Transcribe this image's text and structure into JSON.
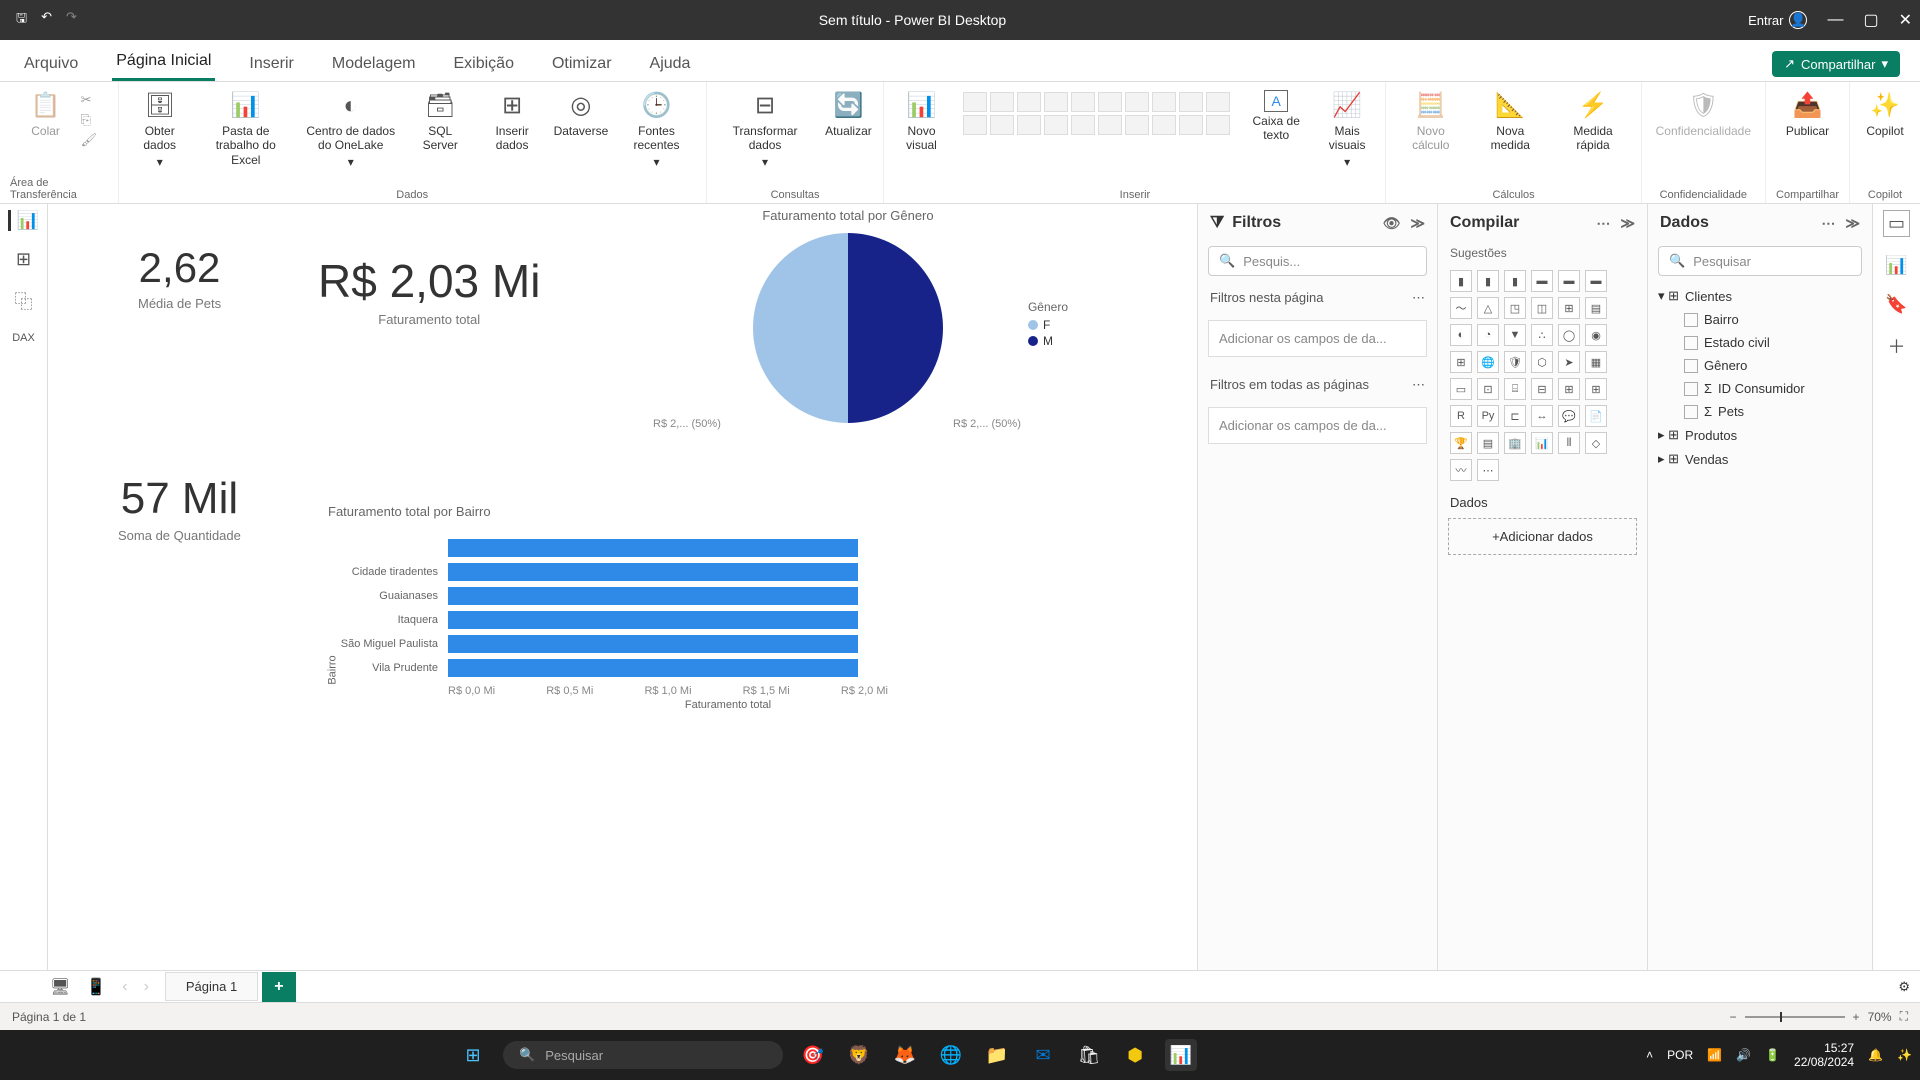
{
  "titlebar": {
    "title": "Sem título - Power BI Desktop",
    "signin": "Entrar"
  },
  "ribbon_tabs": [
    "Arquivo",
    "Página Inicial",
    "Inserir",
    "Modelagem",
    "Exibição",
    "Otimizar",
    "Ajuda"
  ],
  "share_label": "Compartilhar",
  "ribbon_groups": {
    "clipboard": {
      "label": "Área de Transferência",
      "paste": "Colar"
    },
    "data": {
      "label": "Dados",
      "get_data": "Obter dados",
      "excel": "Pasta de trabalho do Excel",
      "onelake": "Centro de dados do OneLake",
      "sql": "SQL Server",
      "enter": "Inserir dados",
      "dataverse": "Dataverse",
      "recent": "Fontes recentes"
    },
    "queries": {
      "label": "Consultas",
      "transform": "Transformar dados",
      "refresh": "Atualizar"
    },
    "insert": {
      "label": "Inserir",
      "new_visual": "Novo visual",
      "textbox": "Caixa de texto",
      "more": "Mais visuais"
    },
    "calc": {
      "label": "Cálculos",
      "new_calc": "Novo cálculo",
      "new_measure": "Nova medida",
      "quick": "Medida rápida"
    },
    "sens": {
      "label": "Confidencialidade",
      "item": "Confidencialidade"
    },
    "share": {
      "label": "Compartilhar",
      "publish": "Publicar"
    },
    "copilot": {
      "label": "Copilot",
      "item": "Copilot"
    }
  },
  "dashboard": {
    "card1": {
      "value": "2,62",
      "caption": "Média de Pets"
    },
    "card2": {
      "value": "R$ 2,03 Mi",
      "caption": "Faturamento total"
    },
    "card3": {
      "value": "57 Mil",
      "caption": "Soma de Quantidade"
    },
    "pie_title": "Faturamento total por Gênero",
    "bar_title": "Faturamento total por Bairro"
  },
  "chart_data": [
    {
      "type": "pie",
      "title": "Faturamento total por Gênero",
      "legend_title": "Gênero",
      "series": [
        {
          "name": "F",
          "value": 50,
          "label": "R$ 2,... (50%)",
          "color": "#a0c4e8"
        },
        {
          "name": "M",
          "value": 50,
          "label": "R$ 2,... (50%)",
          "color": "#18238a"
        }
      ]
    },
    {
      "type": "bar",
      "orientation": "horizontal",
      "title": "Faturamento total por Bairro",
      "xlabel": "Faturamento total",
      "ylabel": "Bairro",
      "categories": [
        "",
        "Cidade tiradentes",
        "Guaianases",
        "Itaquera",
        "São Miguel Paulista",
        "Vila Prudente"
      ],
      "values": [
        2.0,
        2.0,
        2.0,
        2.0,
        2.0,
        2.0
      ],
      "x_ticks": [
        "R$ 0,0 Mi",
        "R$ 0,5 Mi",
        "R$ 1,0 Mi",
        "R$ 1,5 Mi",
        "R$ 2,0 Mi"
      ],
      "xlim": [
        0,
        2.05
      ]
    }
  ],
  "filters_pane": {
    "title": "Filtros",
    "search_placeholder": "Pesquis...",
    "on_page": "Filtros nesta página",
    "add_fields": "Adicionar os campos de da...",
    "all_pages": "Filtros em todas as páginas"
  },
  "compilar_pane": {
    "title": "Compilar",
    "suggestions": "Sugestões",
    "data_section": "Dados",
    "add_data": "+Adicionar dados"
  },
  "dados_pane": {
    "title": "Dados",
    "search_placeholder": "Pesquisar",
    "tables": {
      "clientes": {
        "name": "Clientes",
        "fields": [
          "Bairro",
          "Estado civil",
          "Gênero",
          "ID Consumidor",
          "Pets"
        ]
      },
      "produtos": "Produtos",
      "vendas": "Vendas"
    }
  },
  "page_tab": "Página 1",
  "status": {
    "page": "Página 1 de 1",
    "zoom": "70%"
  },
  "taskbar": {
    "search": "Pesquisar",
    "lang": "POR",
    "time": "15:27",
    "date": "22/08/2024"
  }
}
